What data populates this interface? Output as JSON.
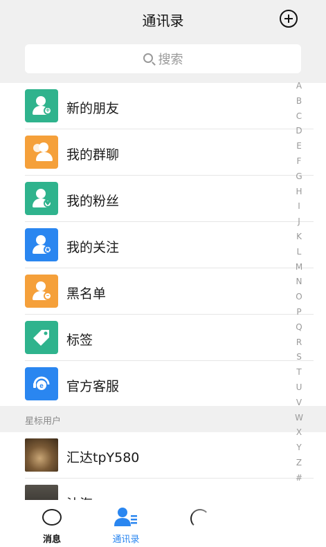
{
  "header": {
    "title": "通讯录",
    "search_placeholder": "搜索"
  },
  "menu": [
    {
      "label": "新的朋友",
      "icon": "new-friend-icon",
      "color": "#2fb38d"
    },
    {
      "label": "我的群聊",
      "icon": "group-chat-icon",
      "color": "#f5a03a"
    },
    {
      "label": "我的粉丝",
      "icon": "fans-icon",
      "color": "#2fb38d"
    },
    {
      "label": "我的关注",
      "icon": "following-icon",
      "color": "#2a86f0"
    },
    {
      "label": "黑名单",
      "icon": "blacklist-icon",
      "color": "#f5a03a"
    },
    {
      "label": "标签",
      "icon": "tag-icon",
      "color": "#2fb38d"
    },
    {
      "label": "官方客服",
      "icon": "customer-service-icon",
      "color": "#2a86f0"
    }
  ],
  "starred": {
    "title": "星标用户",
    "users": [
      {
        "name": "汇达tpY580"
      },
      {
        "name": "沐海"
      }
    ]
  },
  "index_letters": [
    "A",
    "B",
    "C",
    "D",
    "E",
    "F",
    "G",
    "H",
    "I",
    "J",
    "K",
    "L",
    "M",
    "N",
    "O",
    "P",
    "Q",
    "R",
    "S",
    "T",
    "U",
    "V",
    "W",
    "X",
    "Y",
    "Z",
    "#"
  ],
  "tabs": [
    {
      "label": "消息",
      "icon": "chat-bubble-icon"
    },
    {
      "label": "通讯录",
      "icon": "contacts-icon",
      "active": true,
      "color": "#2a86f0"
    },
    {
      "label": "",
      "icon": "discover-icon"
    }
  ]
}
